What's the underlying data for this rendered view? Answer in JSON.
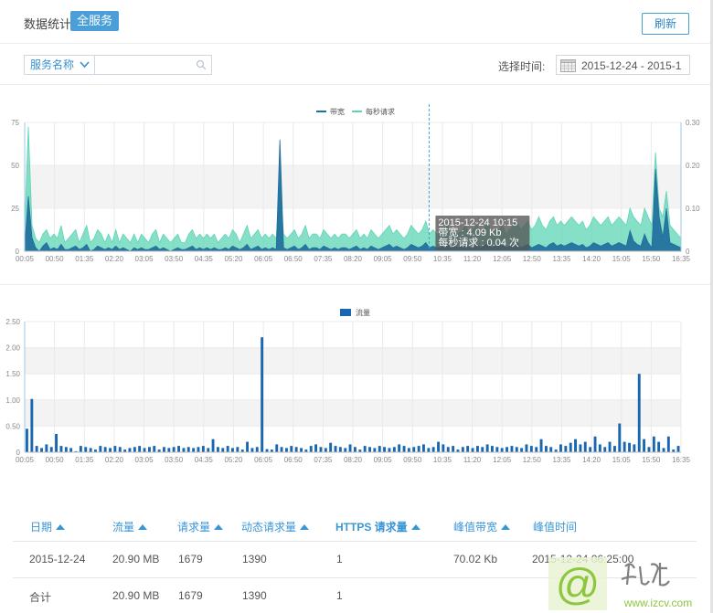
{
  "header": {
    "title": "数据统计",
    "scope_badge": "全服务",
    "refresh_label": "刷新"
  },
  "filters": {
    "service_select_label": "服务名称",
    "service_search_value": "",
    "time_label": "选择时间:",
    "date_range": "2015-12-24 - 2015-1"
  },
  "chart_data": [
    {
      "type": "area",
      "legend": [
        "带宽",
        "每秒请求"
      ],
      "legend_placement": "top-center",
      "colors": {
        "bandwidth": "#1f6e9c",
        "requests": "#5dd5b5"
      },
      "x_ticks": [
        "00:05",
        "00:50",
        "01:35",
        "02:20",
        "03:05",
        "03:50",
        "04:35",
        "05:20",
        "06:05",
        "06:50",
        "07:35",
        "08:20",
        "09:05",
        "09:50",
        "10:35",
        "11:20",
        "12:05",
        "12:50",
        "13:35",
        "14:20",
        "15:05",
        "15:50",
        "16:35"
      ],
      "y_left_ticks": [
        "0",
        "25",
        "50",
        "75"
      ],
      "y_right_ticks": [
        "0",
        "0.10",
        "0.20",
        "0.30"
      ],
      "ylim_left": [
        0,
        75
      ],
      "ylim_right": [
        0,
        0.3
      ],
      "grid": true,
      "series": [
        {
          "name": "带宽",
          "axis": "left",
          "values": [
            3,
            32,
            8,
            2,
            0,
            3,
            5,
            1,
            2,
            1,
            4,
            1,
            1,
            2,
            3,
            1,
            2,
            4,
            0,
            1,
            3,
            2,
            1,
            2,
            1,
            3,
            1,
            2,
            1,
            0,
            2,
            1,
            2,
            1,
            1,
            2,
            3,
            1,
            2,
            1,
            0,
            1,
            2,
            1,
            1,
            2,
            3,
            1,
            2,
            1,
            2,
            1,
            2,
            1,
            1,
            2,
            1,
            3,
            2,
            1,
            2,
            4,
            1,
            2,
            3,
            1,
            2,
            1,
            2,
            1,
            65,
            2,
            1,
            2,
            3,
            1,
            2,
            4,
            1,
            2,
            2,
            1,
            3,
            2,
            1,
            2,
            1,
            2,
            2,
            1,
            2,
            3,
            1,
            2,
            1,
            3,
            2,
            1,
            2,
            3,
            4,
            2,
            3,
            2,
            1,
            2,
            4,
            3,
            2,
            3,
            5,
            2,
            3,
            2,
            2,
            3,
            4,
            2,
            3,
            2,
            3,
            4,
            2,
            3,
            4,
            2,
            3,
            5,
            2,
            3,
            3,
            4,
            2,
            3,
            4,
            5,
            2,
            3,
            4,
            2,
            3,
            4,
            3,
            2,
            4,
            5,
            3,
            4,
            3,
            4,
            5,
            4,
            3,
            4,
            2,
            3,
            5,
            4,
            3,
            4,
            5,
            3,
            4,
            5,
            4,
            3,
            12,
            6,
            4,
            3,
            10,
            5,
            2,
            48,
            20,
            8,
            25,
            5,
            4,
            3,
            2
          ]
        },
        {
          "name": "每秒请求",
          "axis": "right",
          "values": [
            0.05,
            0.29,
            0.06,
            0.03,
            0.02,
            0.04,
            0.05,
            0.03,
            0.04,
            0.03,
            0.06,
            0.02,
            0.03,
            0.04,
            0.05,
            0.02,
            0.04,
            0.06,
            0.02,
            0.03,
            0.05,
            0.04,
            0.02,
            0.04,
            0.02,
            0.05,
            0.02,
            0.04,
            0.03,
            0.02,
            0.04,
            0.02,
            0.04,
            0.03,
            0.02,
            0.04,
            0.05,
            0.02,
            0.04,
            0.03,
            0.02,
            0.03,
            0.04,
            0.02,
            0.02,
            0.04,
            0.05,
            0.03,
            0.04,
            0.03,
            0.04,
            0.03,
            0.04,
            0.02,
            0.03,
            0.04,
            0.03,
            0.05,
            0.04,
            0.02,
            0.04,
            0.06,
            0.03,
            0.04,
            0.05,
            0.03,
            0.04,
            0.03,
            0.04,
            0.03,
            0.16,
            0.04,
            0.03,
            0.04,
            0.05,
            0.03,
            0.04,
            0.06,
            0.03,
            0.04,
            0.04,
            0.03,
            0.05,
            0.04,
            0.03,
            0.04,
            0.03,
            0.04,
            0.04,
            0.03,
            0.04,
            0.05,
            0.03,
            0.04,
            0.03,
            0.05,
            0.04,
            0.03,
            0.04,
            0.05,
            0.06,
            0.04,
            0.05,
            0.04,
            0.03,
            0.04,
            0.06,
            0.05,
            0.04,
            0.05,
            0.07,
            0.04,
            0.05,
            0.04,
            0.04,
            0.05,
            0.06,
            0.04,
            0.05,
            0.04,
            0.05,
            0.06,
            0.04,
            0.05,
            0.06,
            0.04,
            0.05,
            0.07,
            0.04,
            0.05,
            0.05,
            0.06,
            0.04,
            0.05,
            0.06,
            0.07,
            0.05,
            0.06,
            0.07,
            0.05,
            0.06,
            0.08,
            0.06,
            0.05,
            0.07,
            0.08,
            0.06,
            0.07,
            0.06,
            0.07,
            0.08,
            0.07,
            0.06,
            0.07,
            0.05,
            0.06,
            0.08,
            0.07,
            0.06,
            0.07,
            0.08,
            0.06,
            0.07,
            0.08,
            0.07,
            0.06,
            0.1,
            0.08,
            0.07,
            0.06,
            0.1,
            0.08,
            0.06,
            0.23,
            0.1,
            0.08,
            0.14,
            0.06,
            0.05,
            0.04,
            0.03
          ]
        }
      ],
      "tooltip": {
        "x_value": "10:15",
        "lines": [
          "2015-12-24 10:15",
          "带宽 : 4.09 Kb",
          "每秒请求 : 0.04 次"
        ]
      }
    },
    {
      "type": "bar",
      "legend": [
        "流量"
      ],
      "legend_placement": "top-center",
      "colors": {
        "traffic": "#1967b0"
      },
      "x_ticks": [
        "00:05",
        "00:50",
        "01:35",
        "02:20",
        "03:05",
        "03:50",
        "04:35",
        "05:20",
        "06:05",
        "06:50",
        "07:35",
        "08:20",
        "09:05",
        "09:50",
        "10:35",
        "11:20",
        "12:05",
        "12:50",
        "13:35",
        "14:20",
        "15:05",
        "15:50",
        "16:35"
      ],
      "y_ticks": [
        "0",
        "0.50",
        "1.00",
        "1.50",
        "2.00",
        "2.50"
      ],
      "ylim": [
        0,
        2.5
      ],
      "grid": true,
      "series": [
        {
          "name": "流量",
          "values": [
            0.45,
            1.02,
            0.12,
            0.08,
            0.15,
            0.1,
            0.35,
            0.12,
            0.1,
            0.08,
            0.02,
            0.12,
            0.1,
            0.08,
            0.05,
            0.12,
            0.1,
            0.08,
            0.12,
            0.1,
            0.05,
            0.08,
            0.1,
            0.12,
            0.08,
            0.1,
            0.12,
            0.05,
            0.1,
            0.08,
            0.1,
            0.12,
            0.08,
            0.1,
            0.08,
            0.1,
            0.12,
            0.08,
            0.25,
            0.1,
            0.08,
            0.12,
            0.08,
            0.1,
            0.05,
            0.2,
            0.08,
            0.1,
            2.2,
            0.06,
            0.05,
            0.15,
            0.1,
            0.08,
            0.12,
            0.1,
            0.08,
            0.05,
            0.12,
            0.15,
            0.1,
            0.08,
            0.18,
            0.12,
            0.1,
            0.08,
            0.15,
            0.1,
            0.05,
            0.12,
            0.1,
            0.08,
            0.12,
            0.1,
            0.08,
            0.1,
            0.15,
            0.12,
            0.08,
            0.1,
            0.12,
            0.15,
            0.08,
            0.1,
            0.2,
            0.15,
            0.1,
            0.12,
            0.05,
            0.1,
            0.12,
            0.08,
            0.12,
            0.1,
            0.15,
            0.12,
            0.1,
            0.08,
            0.1,
            0.12,
            0.1,
            0.08,
            0.15,
            0.12,
            0.1,
            0.25,
            0.12,
            0.1,
            0.05,
            0.15,
            0.12,
            0.18,
            0.25,
            0.15,
            0.2,
            0.1,
            0.3,
            0.15,
            0.1,
            0.2,
            0.12,
            0.55,
            0.2,
            0.18,
            0.15,
            1.5,
            0.25,
            0.1,
            0.3,
            0.2,
            0.08,
            0.3,
            0.05,
            0.12
          ]
        }
      ]
    }
  ],
  "table": {
    "headers": [
      {
        "label": "日期",
        "sortable": true
      },
      {
        "label": "流量",
        "sortable": true
      },
      {
        "label": "请求量",
        "sortable": true
      },
      {
        "label": "动态请求量",
        "sortable": true
      },
      {
        "label": "HTTPS 请求量",
        "sortable": true
      },
      {
        "label": "峰值带宽",
        "sortable": true
      },
      {
        "label": "峰值时间",
        "sortable": false
      }
    ],
    "rows": [
      {
        "date": "2015-12-24",
        "traffic": "20.90 MB",
        "requests": "1679",
        "dynamic_requests": "1390",
        "https_requests": "1",
        "peak_bandwidth": "70.02 Kb",
        "peak_time": "2015-12-24 06:25:00"
      },
      {
        "date": "合计",
        "traffic": "20.90 MB",
        "requests": "1679",
        "dynamic_requests": "1390",
        "https_requests": "1",
        "peak_bandwidth": "",
        "peak_time": ""
      }
    ]
  },
  "watermark": {
    "text": "www.izcv.com"
  }
}
